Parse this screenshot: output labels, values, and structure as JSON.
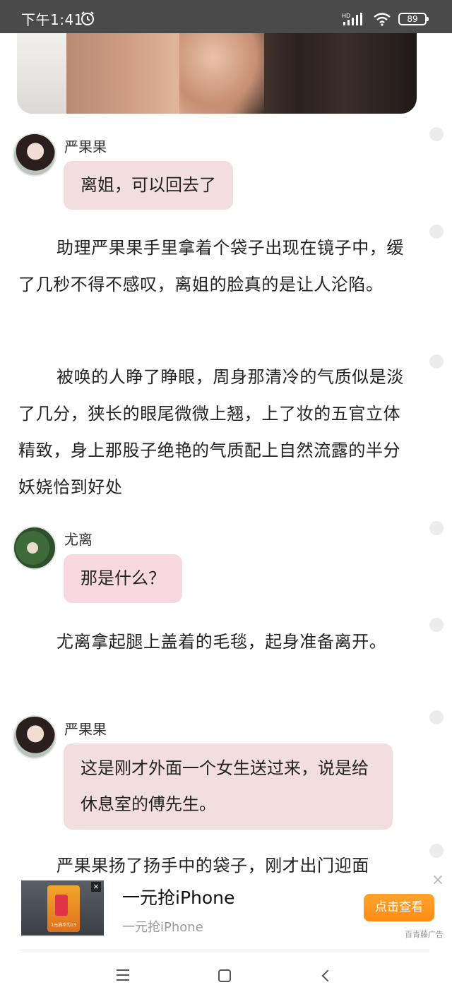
{
  "status_bar": {
    "time": "下午1:41",
    "network_label": "HD",
    "battery": "89"
  },
  "messages": [
    {
      "speaker": "严果果",
      "text": "离姐，可以回去了"
    },
    {
      "speaker": "尤离",
      "text": "那是什么？"
    },
    {
      "speaker": "严果果",
      "text": "这是刚才外面一个女生送过来，说是给休息室的傅先生。"
    }
  ],
  "paragraphs": [
    "助理严果果手里拿着个袋子出现在镜子中，缓了几秒不得不感叹，离姐的脸真的是让人沦陷。",
    "被唤的人睁了睁眼，周身那清冷的气质似是淡了几分，狭长的眼尾微微上翘，上了妆的五官立体精致，身上那股子绝艳的气质配上自然流露的半分妖娆恰到好处",
    "尤离拿起腿上盖着的毛毯，起身准备离开。",
    "严果果扬了扬手中的袋子，刚才出门迎面"
  ],
  "ad": {
    "title": "一元抢iPhone",
    "subtitle": "一元抢iPhone",
    "button": "点击查看",
    "source": "百青藤广告",
    "image_caption": "1元抽华为13"
  },
  "colors": {
    "status_bar": "#4a4a4a",
    "bubble_yan": "#f2dede",
    "bubble_you": "#f9d9e1",
    "ad_button": "#ff9a20"
  }
}
